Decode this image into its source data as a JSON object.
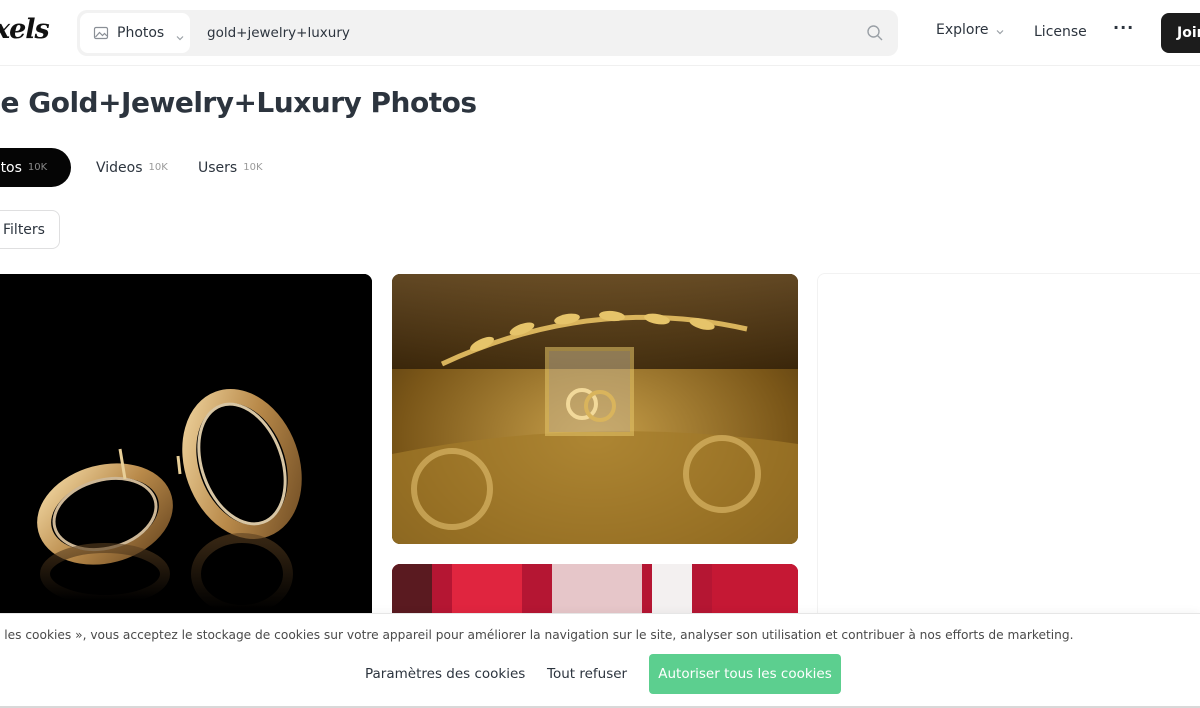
{
  "header": {
    "logo_text": "xels",
    "search": {
      "type_label": "Photos",
      "type_icon": "image-icon",
      "query": "gold+jewelry+luxury"
    },
    "nav": {
      "explore": "Explore",
      "license": "License",
      "more": "···",
      "join": "Join"
    }
  },
  "main": {
    "title": "ee Gold+Jewelry+Luxury Photos",
    "tabs": [
      {
        "label": "otos",
        "count": "10K"
      },
      {
        "label": "Videos",
        "count": "10K"
      },
      {
        "label": "Users",
        "count": "10K"
      }
    ],
    "filters_label": "Filters",
    "photos": [
      {
        "subject": "gold hoop earrings on black"
      },
      {
        "subject": "gold rings in glass box with laurel crown"
      },
      {
        "subject": "red blurred photo"
      },
      {
        "subject": "blank photo placeholder"
      }
    ]
  },
  "cookie_banner": {
    "text": "s les cookies », vous acceptez le stockage de cookies sur votre appareil pour améliorer la navigation sur le site, analyser son utilisation et contribuer à nos efforts de marketing.",
    "settings": "Paramètres des cookies",
    "refuse": "Tout refuser",
    "accept": "Autoriser tous les cookies"
  },
  "colors": {
    "accent_green": "#5ccf8f",
    "dark": "#050505",
    "text": "#2c343e"
  }
}
